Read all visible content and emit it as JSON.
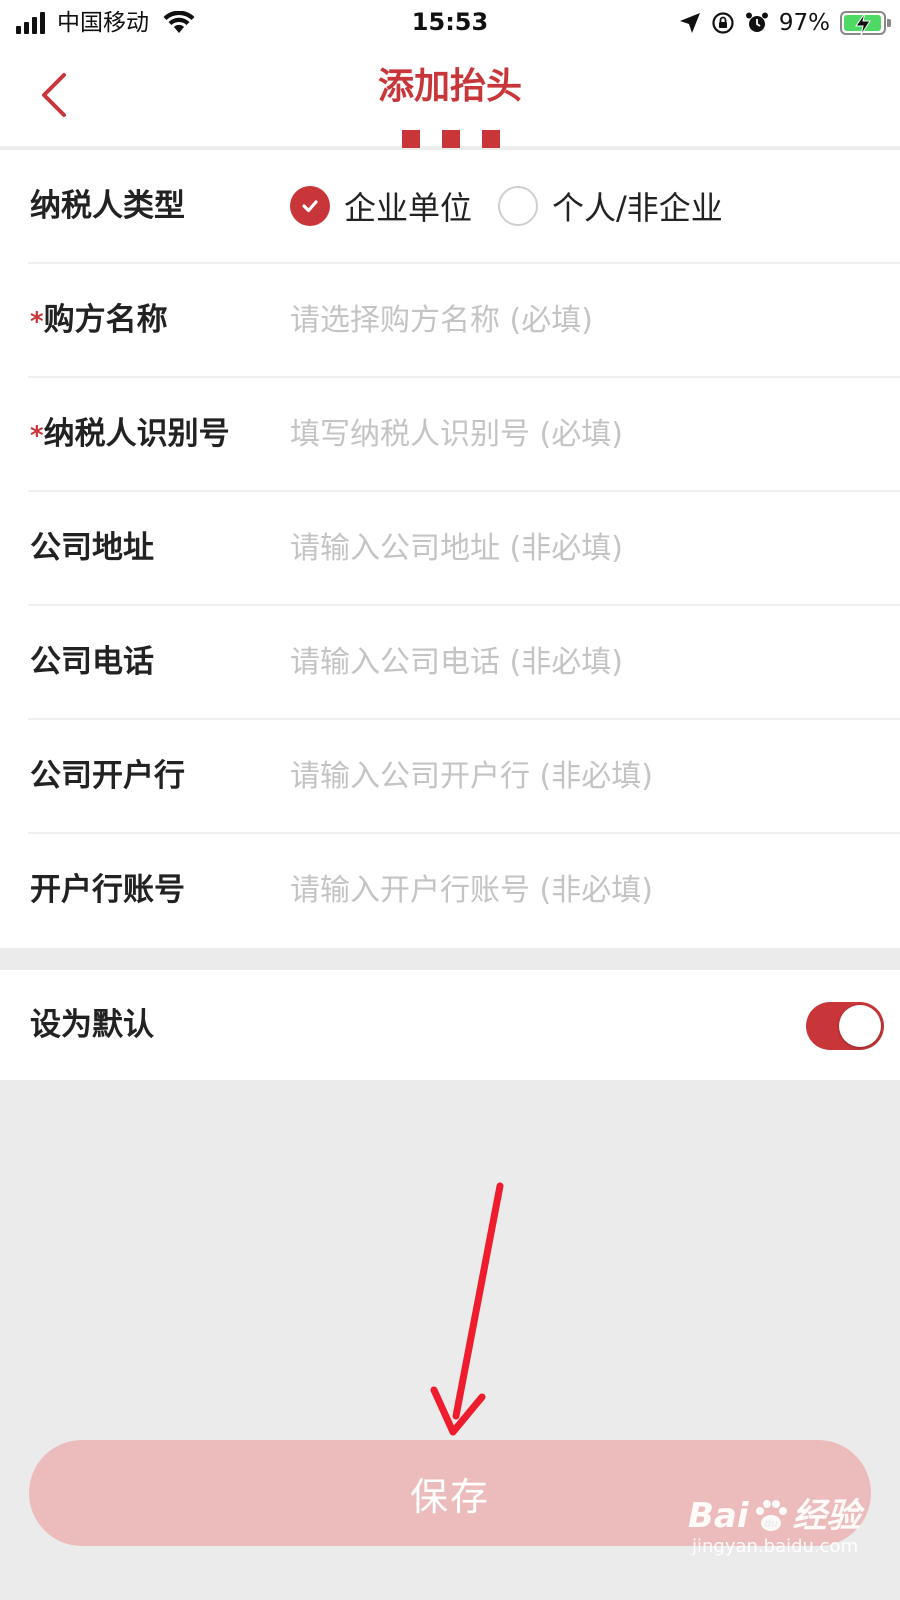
{
  "status_bar": {
    "carrier": "中国移动",
    "time": "15:53",
    "battery": "97%",
    "battery_level": 0.97
  },
  "nav": {
    "title": "添加抬头"
  },
  "form": {
    "taxpayer_type": {
      "label": "纳税人类型",
      "options": [
        "企业单位",
        "个人/非企业"
      ],
      "selected": "企业单位"
    },
    "rows": [
      {
        "required": true,
        "required_mark": "*",
        "label": "购方名称",
        "placeholder": "请选择购方名称 (必填)"
      },
      {
        "required": true,
        "required_mark": "*",
        "label": "纳税人识别号",
        "placeholder": "填写纳税人识别号 (必填)"
      },
      {
        "required": false,
        "label": "公司地址",
        "placeholder": "请输入公司地址 (非必填)"
      },
      {
        "required": false,
        "label": "公司电话",
        "placeholder": "请输入公司电话 (非必填)"
      },
      {
        "required": false,
        "label": "公司开户行",
        "placeholder": "请输入公司开户行 (非必填)"
      },
      {
        "required": false,
        "label": "开户行账号",
        "placeholder": "请输入开户行账号 (非必填)"
      }
    ]
  },
  "default_setting": {
    "label": "设为默认",
    "enabled": true
  },
  "save_label": "保存",
  "watermark": {
    "brand_left": "Bai",
    "brand_right": "经验",
    "url": "jingyan.baidu.com"
  },
  "colors": {
    "accent": "#c8363a",
    "save_button": "#ecbcbc",
    "annotation_arrow": "#ee1c2d",
    "placeholder": "#c4c4c4",
    "background": "#ebebeb"
  }
}
